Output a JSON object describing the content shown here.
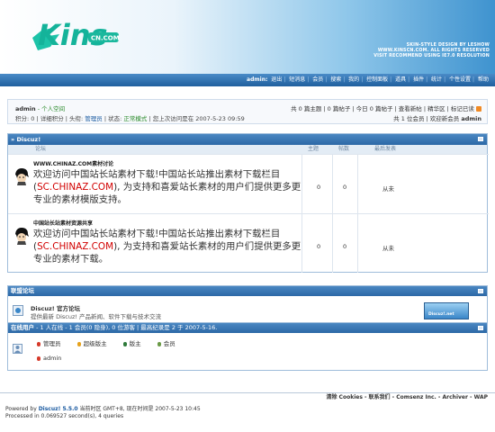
{
  "header": {
    "logo_text": "Kins",
    "logo_sub": "CN.COM",
    "lines": [
      "SKIN-STYLE DESIGN BY LESHOW",
      "WWW.KINSCN.COM.  ALL RIGHTS RESERVED",
      "VISIT RECOMMEND USING IE7.0 RESOLUTION"
    ]
  },
  "topnav": [
    "admin:",
    "退出",
    "短消息",
    "会员",
    "搜索",
    "我的",
    "控制面板",
    "道具",
    "插件",
    "统计",
    "个性设置",
    "帮助"
  ],
  "userbox": {
    "name": "admin",
    "space": "- 个人空间",
    "l2a": "积分: 0 | 详细积分 | 头衔: ",
    "title": "管理员",
    "l2b": " | 状态: ",
    "status": "正常模式",
    "l2c": " | 您上次访问是在 2007-5-23 09:59",
    "r1": "共 0 篇主题 | 0 篇帖子 | 今日 0 篇帖子 | 查看新帖 | 精华区 | 标记已读",
    "r2a": "共 1 位会员 | 欢迎新会员 ",
    "r2b": "admin"
  },
  "forum": {
    "category": "» Discuz!",
    "cols": {
      "forum": "论坛",
      "topics": "主题",
      "posts": "帖数",
      "last": "最后发表"
    },
    "rows": [
      {
        "title": "WWW.CHINAZ.COM素材讨论",
        "desc_a": "欢迎访问中国站长站素材下载!中国站长站推出素材下载栏目(",
        "desc_red": "SC.CHINAZ.COM",
        "desc_b": "), 为支持和喜爱站长素材的用户们提供更多更专业的素材模版支持。",
        "topics": "0",
        "posts": "0",
        "last": "从未"
      },
      {
        "title": "中国站长站素材资源共享",
        "desc_a": "欢迎访问中国站长站素材下载!中国站长站推出素材下载栏目(",
        "desc_red": "SC.CHINAZ.COM",
        "desc_b": "), 为支持和喜爱站长素材的用户们提供更多更专业的素材下载。",
        "topics": "0",
        "posts": "0",
        "last": "从未"
      }
    ]
  },
  "links": {
    "header": "联盟论坛",
    "title": "Discuz! 官方论坛",
    "desc": "提供最新 Discuz! 产品新闻、软件下载与技术交流",
    "badge": "Discuz!.net"
  },
  "online": {
    "label": "在线用户",
    "summary": " - 1 人在线 - 1 会员(0 隐身), 0 位游客 | 最高纪录是 2 于 2007-5-16.",
    "legend": [
      {
        "label": "管理员",
        "color": "#d63a2a"
      },
      {
        "label": "超级版主",
        "color": "#e6a21c"
      },
      {
        "label": "版主",
        "color": "#2f7a3a"
      },
      {
        "label": "会员",
        "color": "#6a9a46"
      }
    ],
    "users": [
      {
        "name": "admin",
        "color": "#d63a2a"
      }
    ]
  },
  "footer": {
    "links": "清除 Cookies - 联系我们 - Comsenz Inc. - Archiver - WAP",
    "powered_a": "Powered by ",
    "powered_b": "Discuz! 5.5.0",
    "powered_c": "  当前时区 GMT+8, 现在时间是 2007-5-23 10:45",
    "processed": "Processed in 0.069527 second(s), 4 queries"
  }
}
